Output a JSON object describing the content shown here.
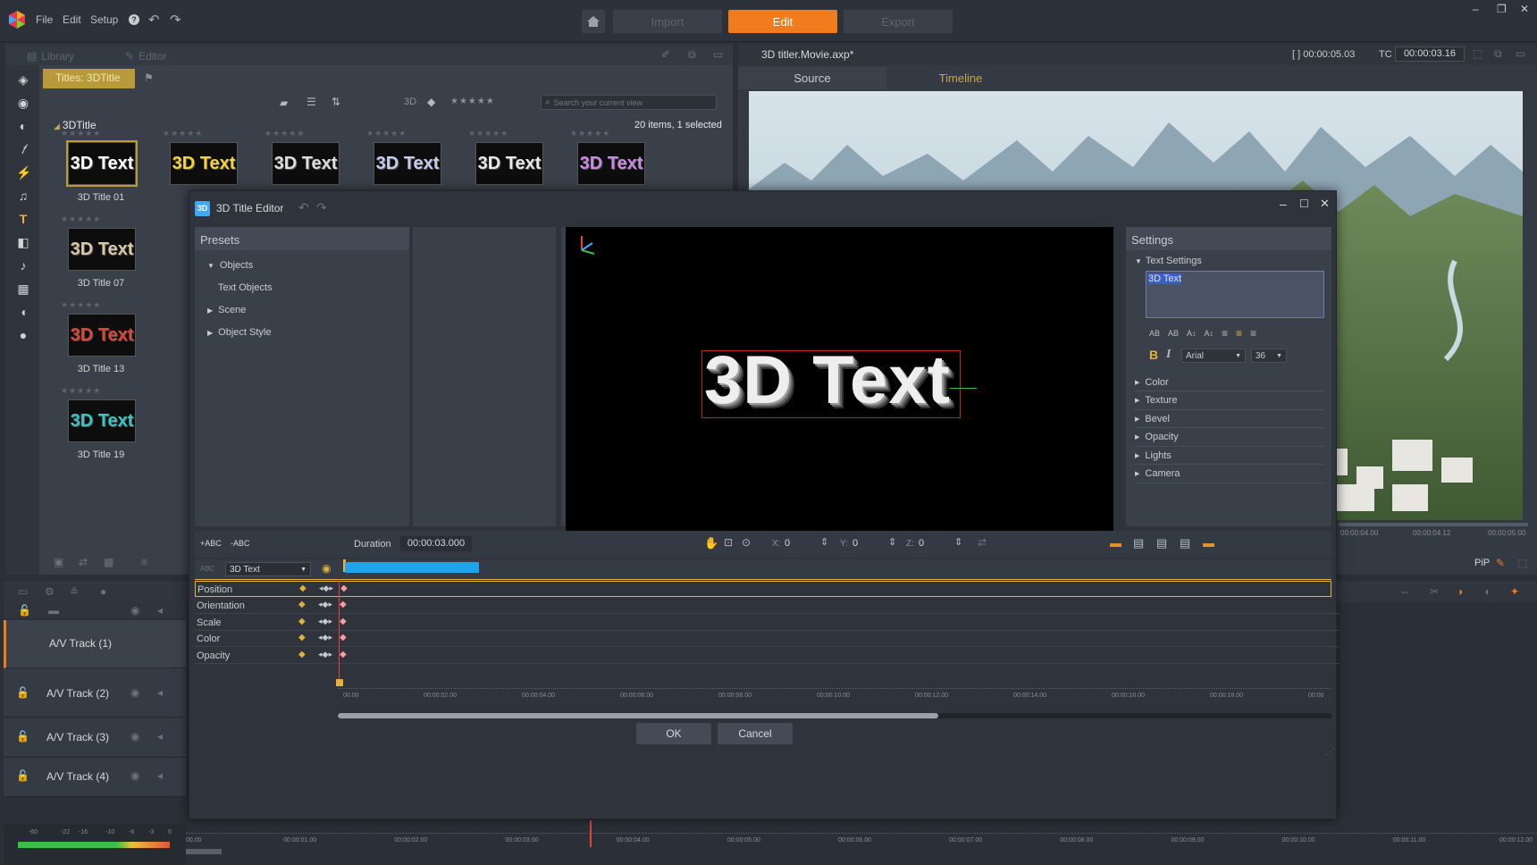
{
  "app": {
    "menu": [
      "File",
      "Edit",
      "Setup"
    ],
    "modes": [
      "Import",
      "Edit",
      "Export"
    ],
    "active_mode": "Edit",
    "accent": "#f07c1e"
  },
  "library": {
    "tabs": [
      "Library",
      "Editor"
    ],
    "collection": "Titles: 3DTitle",
    "search_placeholder": "Search your current view",
    "view_label": "3D",
    "folder": "3DTitle",
    "count": "20 items, 1 selected",
    "thumbs": [
      {
        "label": "3D Title 01",
        "text": "3D Text",
        "color": "#ffffff"
      },
      {
        "label": "",
        "text": "3D Text",
        "color": "#f5d23a"
      },
      {
        "label": "",
        "text": "3D Text",
        "color": "#dddddd"
      },
      {
        "label": "",
        "text": "3D Text",
        "color": "#c9c9ee"
      },
      {
        "label": "",
        "text": "3D Text",
        "color": "#e8e8e8"
      },
      {
        "label": "",
        "text": "3D Text",
        "color": "#c98be0"
      },
      {
        "label": "3D Title 07",
        "text": "3D Text",
        "color": "#d9c6a4"
      },
      {
        "label": "3D Title 13",
        "text": "3D Text",
        "color": "#d8463a"
      },
      {
        "label": "3D Title 19",
        "text": "3D Text",
        "color": "#3bc2c2"
      }
    ]
  },
  "movie": {
    "file": "3D titler.Movie.axp*",
    "duration": "00:00:05.03",
    "tc_label": "TC",
    "timecode": "00:00:03.16",
    "tabs": [
      "Source",
      "Timeline"
    ],
    "scrub_ticks": [
      "00:00:04.00",
      "00:00:04.12",
      "00:00:05.00"
    ],
    "pip": "PiP"
  },
  "tracks": [
    "A/V Track (1)",
    "A/V Track (2)",
    "A/V Track (3)",
    "A/V Track (4)"
  ],
  "meter_labels": [
    "-60",
    "-22",
    "-16",
    "-10",
    "-6",
    "-3",
    "0"
  ],
  "main_ruler": [
    "00.00",
    "00:00:01.00",
    "00:00:02.00",
    "00:00:03.00",
    "00:00:04.00",
    "00:00:05.00",
    "00:00:06.00",
    "00:00:07.00",
    "00:00:08.00",
    "00:00:09.00",
    "00:00:10.00",
    "00:00:11.00",
    "00:00:12.00"
  ],
  "dialog": {
    "title": "3D Title Editor",
    "presets_title": "Presets",
    "presets_tree": [
      {
        "label": "Objects",
        "level": 0,
        "expanded": true
      },
      {
        "label": "Text Objects",
        "level": 1
      },
      {
        "label": "Scene",
        "level": 0,
        "expanded": false
      },
      {
        "label": "Object Style",
        "level": 0,
        "expanded": false
      }
    ],
    "preview_text": "3D Text",
    "settings_title": "Settings",
    "text_settings_label": "Text Settings",
    "text_value": "3D Text",
    "font": "Arial",
    "font_size": "36",
    "setting_groups": [
      "Color",
      "Texture",
      "Bevel",
      "Opacity",
      "Lights",
      "Camera"
    ],
    "add_text": "+ABC",
    "remove_text": "-ABC",
    "duration_label": "Duration",
    "duration_value": "00:00:03.000",
    "x_label": "X:",
    "x_value": "0",
    "y_label": "Y:",
    "y_value": "0",
    "z_label": "Z:",
    "z_value": "0",
    "layer_select": "3D Text",
    "keyframe_rows": [
      "Position",
      "Orientation",
      "Scale",
      "Color",
      "Opacity"
    ],
    "ruler": [
      "00.00",
      "00:00:02.00",
      "00:00:04.00",
      "00:00:06.00",
      "00:00:08.00",
      "00:00:10.00",
      "00:00:12.00",
      "00:00:14.00",
      "00:00:16.00",
      "00:00:18.00",
      "00:00"
    ],
    "ok": "OK",
    "cancel": "Cancel"
  }
}
